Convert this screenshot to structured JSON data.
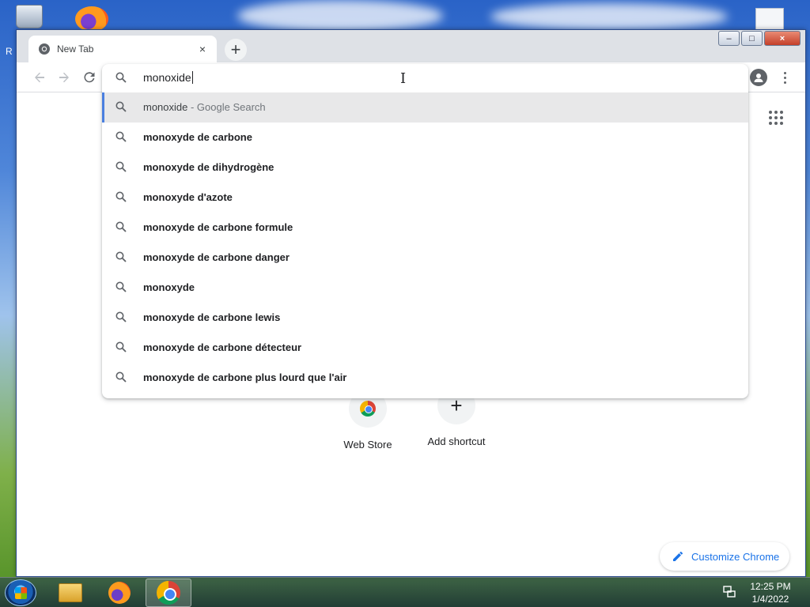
{
  "desktop": {
    "partial_label": "R"
  },
  "browser": {
    "tab": {
      "title": "New Tab",
      "close_glyph": "×"
    },
    "new_tab_glyph": "+",
    "window_controls": {
      "minimize": "–",
      "maximize": "□",
      "close": "×"
    }
  },
  "omnibox": {
    "value": "monoxide",
    "suggestions": [
      {
        "text": "monoxide",
        "suffix": " - Google Search",
        "selected": true
      },
      {
        "text": "monoxyde de carbone"
      },
      {
        "text": "monoxyde de dihydrogène"
      },
      {
        "text": "monoxyde d'azote"
      },
      {
        "text": "monoxyde de carbone formule"
      },
      {
        "text": "monoxyde de carbone danger"
      },
      {
        "text": "monoxyde"
      },
      {
        "text": "monoxyde de carbone lewis"
      },
      {
        "text": "monoxyde de carbone détecteur"
      },
      {
        "text": "monoxyde de carbone plus lourd que l'air"
      }
    ]
  },
  "ntp": {
    "shortcuts": [
      {
        "label": "Web Store"
      },
      {
        "label": "Add shortcut",
        "glyph": "+"
      }
    ],
    "customize_label": "Customize Chrome"
  },
  "taskbar": {
    "time": "12:25 PM",
    "date": "1/4/2022"
  },
  "colors": {
    "accent": "#1a73e8",
    "selected_row": "#e8e8e9",
    "selected_bar": "#4a7fe0",
    "tabstrip": "#dee1e6"
  },
  "icons": {
    "search": "search-icon",
    "back": "back-arrow-icon",
    "forward": "forward-arrow-icon",
    "reload": "reload-icon",
    "profile": "profile-icon",
    "menu": "kebab-menu-icon",
    "apps": "apps-grid-icon",
    "pencil": "pencil-icon"
  }
}
